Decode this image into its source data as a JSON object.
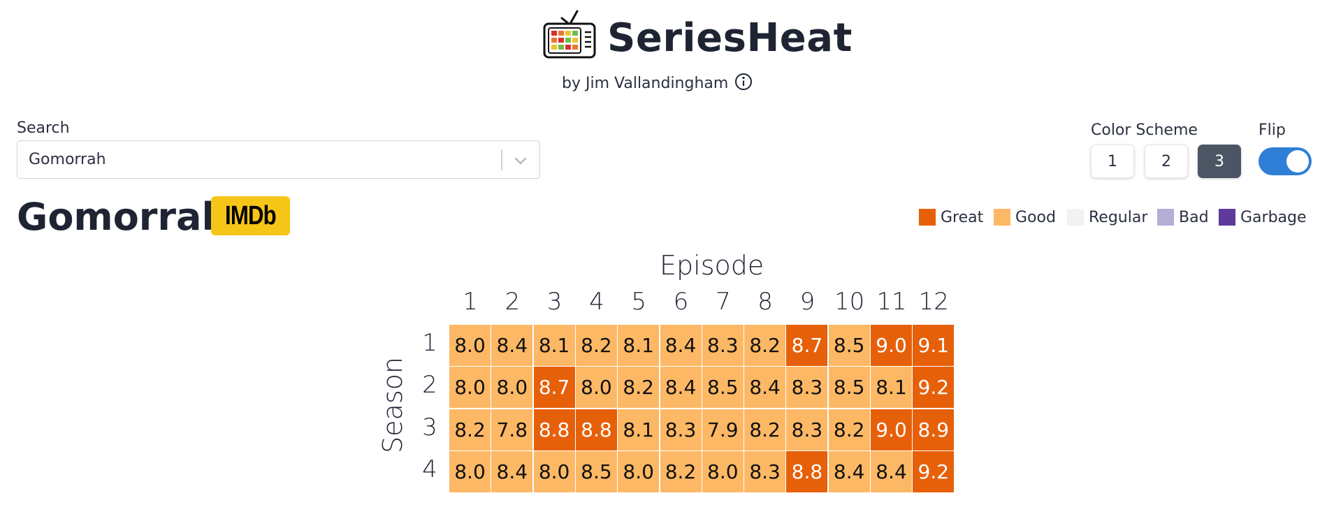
{
  "header": {
    "app_title": "SeriesHeat",
    "byline": "by Jim Vallandingham",
    "logo_icon": "tv-heatmap-icon",
    "info_icon": "info-icon"
  },
  "search": {
    "label": "Search",
    "value": "Gomorrah",
    "dropdown_icon": "chevron-down-icon"
  },
  "color_scheme": {
    "label": "Color Scheme",
    "options": [
      "1",
      "2",
      "3"
    ],
    "selected": "3"
  },
  "flip": {
    "label": "Flip",
    "on": true
  },
  "show": {
    "title": "Gomorrah",
    "imdb_label": "IMDb"
  },
  "legend": [
    {
      "label": "Great",
      "color": "#e6600a"
    },
    {
      "label": "Good",
      "color": "#fdb865"
    },
    {
      "label": "Regular",
      "color": "#f2f2f2"
    },
    {
      "label": "Bad",
      "color": "#b6aed6"
    },
    {
      "label": "Garbage",
      "color": "#5d3a9b"
    }
  ],
  "chart_data": {
    "type": "heatmap",
    "xlabel": "Episode",
    "ylabel": "Season",
    "x": [
      "1",
      "2",
      "3",
      "4",
      "5",
      "6",
      "7",
      "8",
      "9",
      "10",
      "11",
      "12"
    ],
    "y": [
      "1",
      "2",
      "3",
      "4"
    ],
    "values": [
      [
        8.0,
        8.4,
        8.1,
        8.2,
        8.1,
        8.4,
        8.3,
        8.2,
        8.7,
        8.5,
        9.0,
        9.1
      ],
      [
        8.0,
        8.0,
        8.7,
        8.0,
        8.2,
        8.4,
        8.5,
        8.4,
        8.3,
        8.5,
        8.1,
        9.2
      ],
      [
        8.2,
        7.8,
        8.8,
        8.8,
        8.1,
        8.3,
        7.9,
        8.2,
        8.3,
        8.2,
        9.0,
        8.9
      ],
      [
        8.0,
        8.4,
        8.0,
        8.5,
        8.0,
        8.2,
        8.0,
        8.3,
        8.8,
        8.4,
        8.4,
        9.2
      ]
    ],
    "great_threshold": 8.6,
    "colors": {
      "great": "#e6600a",
      "good": "#fdb865",
      "great_text": "#ffffff",
      "good_text": "#111111"
    }
  }
}
